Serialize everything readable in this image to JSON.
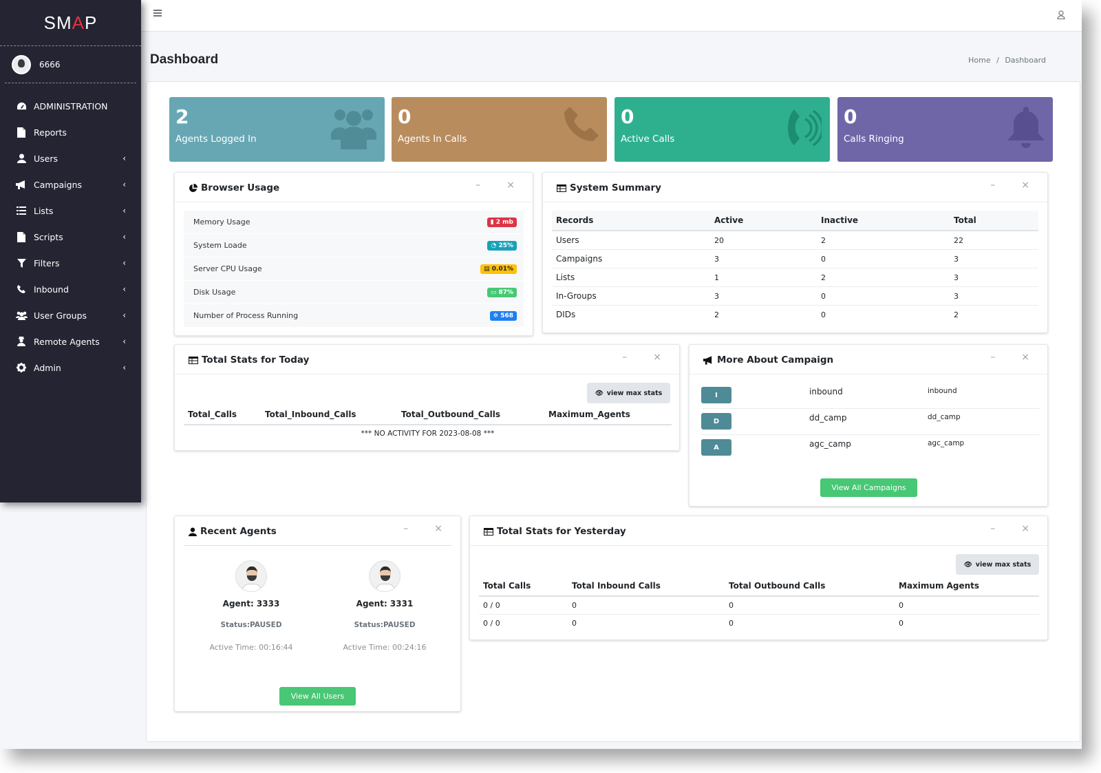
{
  "brand": {
    "name_left": "SM",
    "name_accent": "A",
    "name_right": "P"
  },
  "user": {
    "name": "6666"
  },
  "sidebar": {
    "items": [
      {
        "label": "ADMINISTRATION",
        "icon": "dashboard-icon"
      },
      {
        "label": "Reports",
        "icon": "file-icon"
      },
      {
        "label": "Users",
        "icon": "user-icon"
      },
      {
        "label": "Campaigns",
        "icon": "bullhorn-icon"
      },
      {
        "label": "Lists",
        "icon": "list-icon"
      },
      {
        "label": "Scripts",
        "icon": "file-icon"
      },
      {
        "label": "Filters",
        "icon": "filter-icon"
      },
      {
        "label": "Inbound",
        "icon": "phone-icon"
      },
      {
        "label": "User Groups",
        "icon": "users-icon"
      },
      {
        "label": "Remote Agents",
        "icon": "user-secret-icon"
      },
      {
        "label": "Admin",
        "icon": "gear-icon"
      }
    ]
  },
  "header": {
    "title": "Dashboard",
    "breadcrumb_home": "Home",
    "breadcrumb_sep": "/",
    "breadcrumb_current": "Dashboard"
  },
  "stats": [
    {
      "value": "2",
      "label": "Agents Logged In",
      "color": "#67a7b3",
      "icon": "users-icon"
    },
    {
      "value": "0",
      "label": "Agents In Calls",
      "color": "#b98c5e",
      "icon": "phone-icon"
    },
    {
      "value": "0",
      "label": "Active Calls",
      "color": "#2eb08f",
      "icon": "phone-volume-icon"
    },
    {
      "value": "0",
      "label": "Calls Ringing",
      "color": "#6f66a8",
      "icon": "bell-icon"
    }
  ],
  "browser_usage": {
    "title": "Browser Usage",
    "rows": [
      {
        "label": "Memory Usage",
        "badge": "2 mb",
        "color": "#dc3545"
      },
      {
        "label": "System Loade",
        "badge": "25%",
        "color": "#17a2b8"
      },
      {
        "label": "Server CPU Usage",
        "badge": "0.01%",
        "color": "#ffc107"
      },
      {
        "label": "Disk Usage",
        "badge": "87%",
        "color": "#48c774"
      },
      {
        "label": "Number of Process Running",
        "badge": "568",
        "color": "#1e7ff0"
      }
    ]
  },
  "system_summary": {
    "title": "System Summary",
    "headers": [
      "Records",
      "Active",
      "Inactive",
      "Total"
    ],
    "rows": [
      [
        "Users",
        "20",
        "2",
        "22"
      ],
      [
        "Campaigns",
        "3",
        "0",
        "3"
      ],
      [
        "Lists",
        "1",
        "2",
        "3"
      ],
      [
        "In-Groups",
        "3",
        "0",
        "3"
      ],
      [
        "DIDs",
        "2",
        "0",
        "2"
      ]
    ]
  },
  "stats_today": {
    "title": "Total Stats for Today",
    "button": "view max stats",
    "headers": [
      "Total_Calls",
      "Total_Inbound_Calls",
      "Total_Outbound_Calls",
      "Maximum_Agents"
    ],
    "empty_message": "*** NO ACTIVITY FOR  2023-08-08 ***"
  },
  "campaigns": {
    "title": "More About Campaign",
    "rows": [
      {
        "letter": "I",
        "name": "inbound",
        "id": "inbound"
      },
      {
        "letter": "D",
        "name": "dd_camp",
        "id": "dd_camp"
      },
      {
        "letter": "A",
        "name": "agc_camp",
        "id": "agc_camp"
      }
    ],
    "button": "View All Campaigns"
  },
  "recent_agents": {
    "title": "Recent Agents",
    "agents": [
      {
        "name": "Agent: 3333",
        "status": "Status:PAUSED",
        "time": "Active Time: 00:16:44"
      },
      {
        "name": "Agent: 3331",
        "status": "Status:PAUSED",
        "time": "Active Time: 00:24:16"
      }
    ],
    "button": "View All Users"
  },
  "stats_yesterday": {
    "title": "Total Stats for Yesterday",
    "button": "view max stats",
    "headers": [
      "Total Calls",
      "Total Inbound Calls",
      "Total Outbound Calls",
      "Maximum Agents"
    ],
    "rows": [
      [
        "0 / 0",
        "0",
        "0",
        "0"
      ],
      [
        "0 / 0",
        "0",
        "0",
        "0"
      ]
    ]
  },
  "card_tools": {
    "minimize": "–",
    "close": "×"
  }
}
